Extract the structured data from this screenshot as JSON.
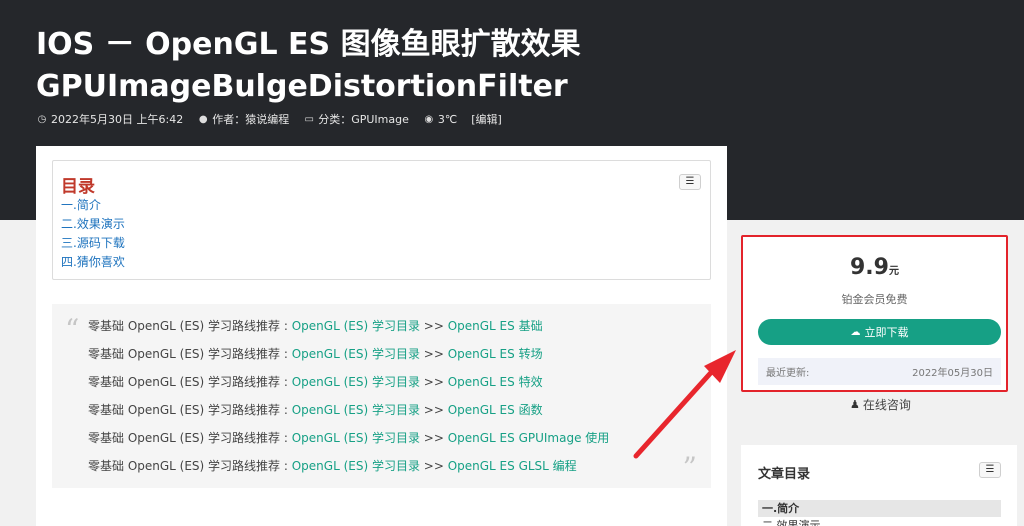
{
  "header": {
    "title_line1": "IOS － OpenGL ES 图像鱼眼扩散效果",
    "title_line2": "GPUImageBulgeDistortionFilter",
    "meta": {
      "date": "2022年5月30日 上午6:42",
      "author": "作者：猿说编程",
      "category": "分类：GPUImage",
      "views": "3℃",
      "edit": "[编辑]"
    }
  },
  "toc": {
    "title": "目录",
    "items": [
      "一.简介",
      "二.效果演示",
      "三.源码下载",
      "四.猜你喜欢"
    ]
  },
  "quote": {
    "prefix": "零基础 OpenGL (ES) 学习路线推荐 : ",
    "link1": "OpenGL (ES) 学习目录",
    "sep": " >> ",
    "lines": [
      "OpenGL ES 基础",
      "OpenGL ES 转场",
      "OpenGL ES 特效",
      "OpenGL ES 函数",
      "OpenGL ES GPUImage 使用",
      "OpenGL ES GLSL 编程"
    ]
  },
  "download": {
    "price": "9.9",
    "unit": "元",
    "member": "铂金会员免费",
    "button": "立即下载",
    "updated_label": "最近更新:",
    "updated_date": "2022年05月30日"
  },
  "consult": "在线咨询",
  "side_toc": {
    "title": "文章目录",
    "items": [
      "一.简介",
      "二.效果演示"
    ]
  },
  "colors": {
    "header_bg": "#25272b",
    "accent_green": "#16a085",
    "link_blue": "#1e73be",
    "highlight_red": "#e3232b",
    "toc_title_red": "#c0392b"
  }
}
